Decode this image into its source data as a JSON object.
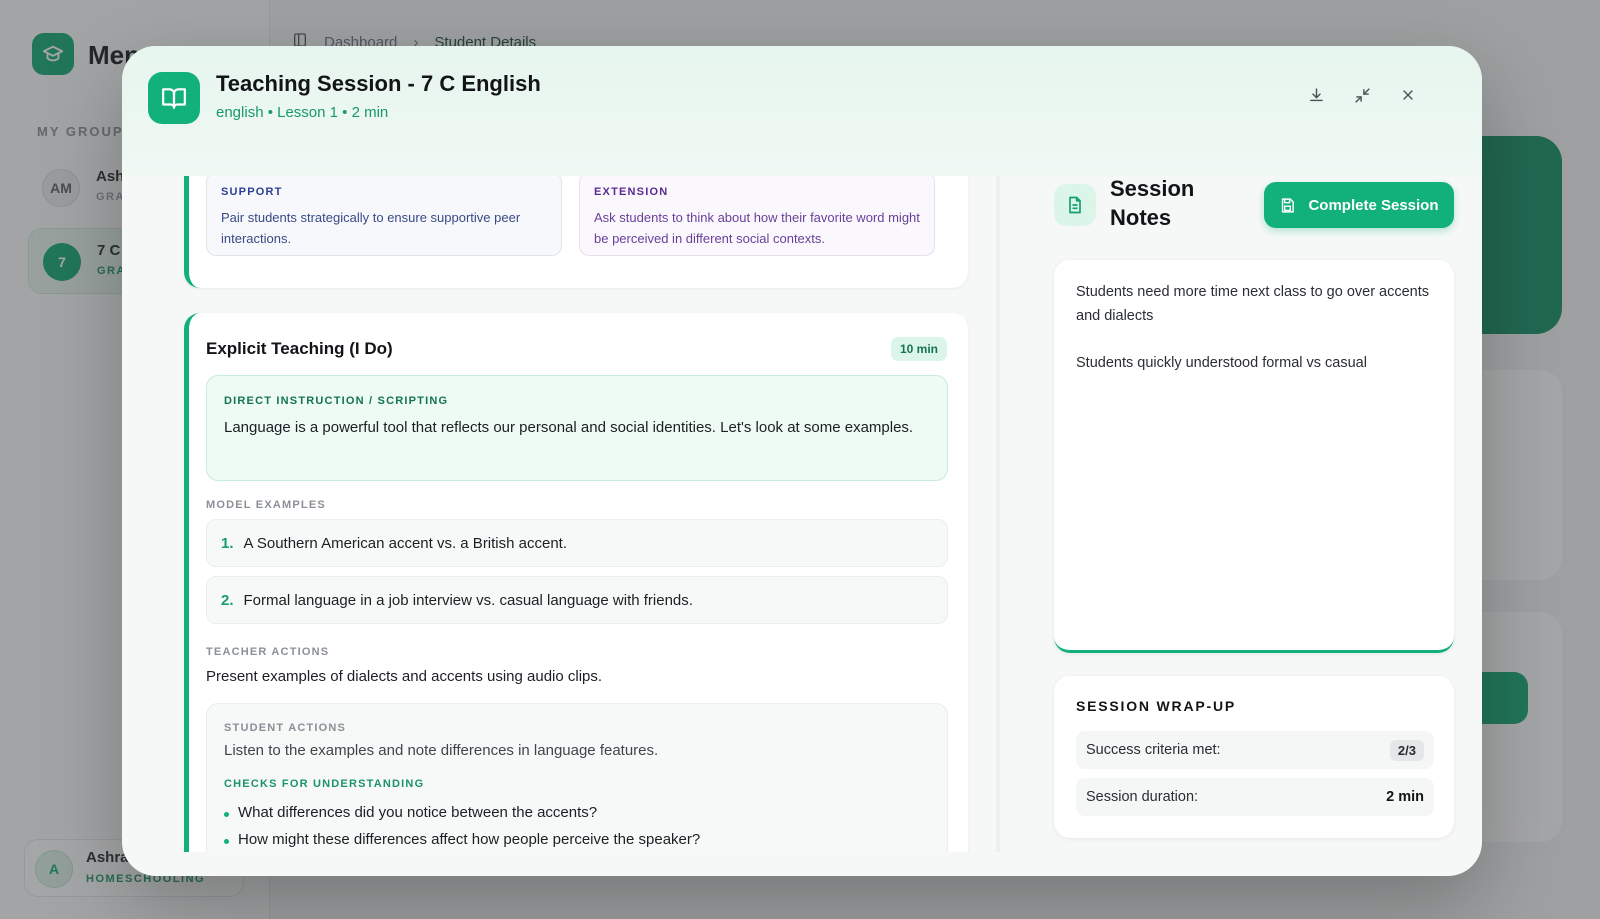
{
  "background": {
    "brand": "Men",
    "section_label": "MY GROUPS",
    "groups": [
      {
        "avatar": "AM",
        "name": "Ash",
        "sub": "GRA"
      },
      {
        "avatar": "7",
        "name": "7 C",
        "sub": "GRA"
      }
    ],
    "breadcrumb": {
      "root": "Dashboard",
      "separator": "›",
      "current": "Student Details"
    },
    "user": {
      "avatar": "A",
      "name": "Ashra",
      "role": "HOMESCHOOLING"
    }
  },
  "modal": {
    "title": "Teaching Session - 7 C English",
    "subtitle": "english • Lesson 1 • 2 min",
    "icons": {
      "book": "book-open-icon",
      "download": "download-icon",
      "minimize": "minimize-icon",
      "close": "close-icon"
    }
  },
  "lesson": {
    "prev": {
      "support": {
        "label": "SUPPORT",
        "text": "Pair students strategically to ensure supportive peer interactions."
      },
      "extension": {
        "label": "EXTENSION",
        "text": "Ask students to think about how their favorite word might be perceived in different social contexts."
      }
    },
    "phase": {
      "title": "Explicit Teaching (I Do)",
      "time": "10 min",
      "direct_label": "DIRECT INSTRUCTION / SCRIPTING",
      "direct_text": "Language is a powerful tool that reflects our personal and social identities. Let's look at some examples.",
      "model_label": "MODEL EXAMPLES",
      "examples": [
        {
          "num": "1.",
          "text": "A Southern American accent vs. a British accent."
        },
        {
          "num": "2.",
          "text": "Formal language in a job interview vs. casual language with friends."
        }
      ],
      "teacher_label": "TEACHER ACTIONS",
      "teacher_text": "Present examples of dialects and accents using audio clips.",
      "student_label": "STUDENT ACTIONS",
      "student_text": "Listen to the examples and note differences in language features.",
      "checks_label": "CHECKS FOR UNDERSTANDING",
      "checks": [
        "What differences did you notice between the accents?",
        "How might these differences affect how people perceive the speaker?"
      ]
    }
  },
  "notes": {
    "title": "Session Notes",
    "complete_label": "Complete Session",
    "lines": [
      "Students need more time next class to go over accents and dialects",
      "Students quickly understood formal vs casual"
    ]
  },
  "wrapup": {
    "title": "SESSION WRAP-UP",
    "criteria_label": "Success criteria met:",
    "criteria_value": "2/3",
    "duration_label": "Session duration:",
    "duration_value": "2 min"
  },
  "colors": {
    "accent": "#12b07a",
    "accent_dark": "#15744f",
    "support": "#2c3f94",
    "extension": "#5b2a93"
  }
}
